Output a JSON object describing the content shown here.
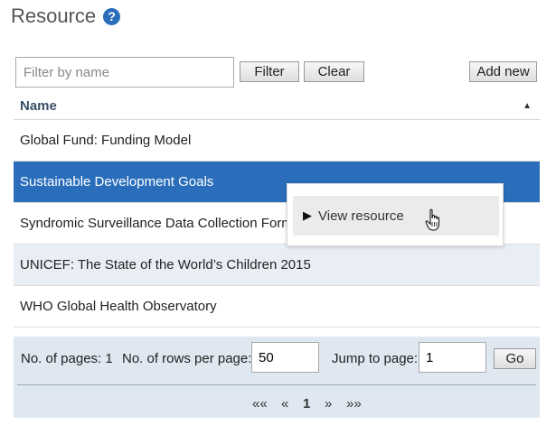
{
  "header": {
    "title": "Resource",
    "help_glyph": "?"
  },
  "filter": {
    "placeholder": "Filter by name",
    "filter_label": "Filter",
    "clear_label": "Clear",
    "add_label": "Add new"
  },
  "table": {
    "column_name": "Name",
    "sort_glyph": "▲",
    "rows": [
      "Global Fund: Funding Model",
      "Sustainable Development Goals",
      "Syndromic Surveillance Data Collection Form",
      "UNICEF: The State of the World’s Children 2015",
      "WHO Global Health Observatory"
    ]
  },
  "context_menu": {
    "item": "View resource",
    "glyph": "▶"
  },
  "pager": {
    "pages_label": "No. of pages: 1",
    "rows_label": "No. of rows per page:",
    "rows_value": "50",
    "jump_label": "Jump to page:",
    "jump_value": "1",
    "go_label": "Go",
    "first": "««",
    "prev": "«",
    "current": "1",
    "next": "»",
    "last": "»»"
  },
  "colors": {
    "accent": "#2a6ebb",
    "alt_row": "#e9eef5",
    "pager_bg": "#dfe7f1"
  }
}
